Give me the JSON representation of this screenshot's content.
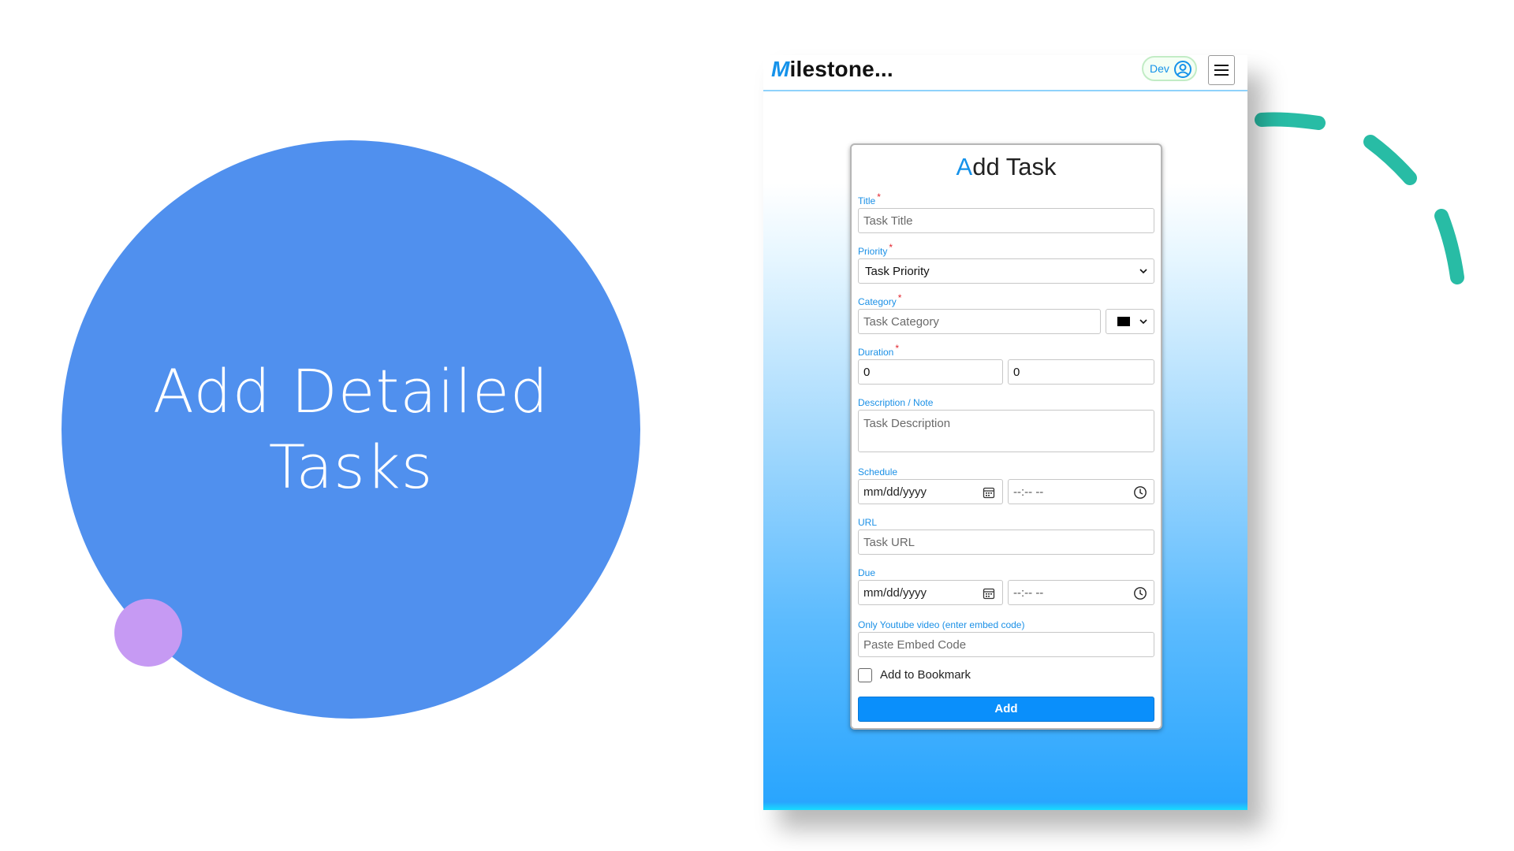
{
  "hero": {
    "title_line1": "Add Detailed",
    "title_line2": "Tasks"
  },
  "colors": {
    "circle": "#5090ee",
    "dot": "#c69af3",
    "arc": "#28bca5",
    "accent": "#1592ea",
    "button": "#0a8ffb",
    "required": "#e3262f"
  },
  "app": {
    "brand_first": "M",
    "brand_rest": "ilestone...",
    "user": {
      "name": "Dev",
      "icon": "user-circle-icon"
    },
    "menu_icon": "hamburger-icon"
  },
  "form": {
    "title_first": "A",
    "title_rest": "dd Task",
    "required_mark": "*",
    "title_field": {
      "label": "Title",
      "placeholder": "Task Title"
    },
    "priority_field": {
      "label": "Priority",
      "selected": "Task Priority"
    },
    "category_field": {
      "label": "Category",
      "placeholder": "Task Category",
      "color": "#000000"
    },
    "duration_field": {
      "label": "Duration",
      "value1": "0",
      "value2": "0"
    },
    "description_field": {
      "label": "Description / Note",
      "placeholder": "Task Description"
    },
    "schedule_field": {
      "label": "Schedule",
      "date_placeholder": "mm/dd/yyyy",
      "time_placeholder": "--:-- --"
    },
    "url_field": {
      "label": "URL",
      "placeholder": "Task URL"
    },
    "due_field": {
      "label": "Due",
      "date_placeholder": "mm/dd/yyyy",
      "time_placeholder": "--:-- --"
    },
    "embed_field": {
      "label": "Only Youtube video (enter embed code)",
      "placeholder": "Paste Embed Code"
    },
    "bookmark": {
      "label": "Add to Bookmark",
      "checked": false
    },
    "submit_label": "Add"
  }
}
